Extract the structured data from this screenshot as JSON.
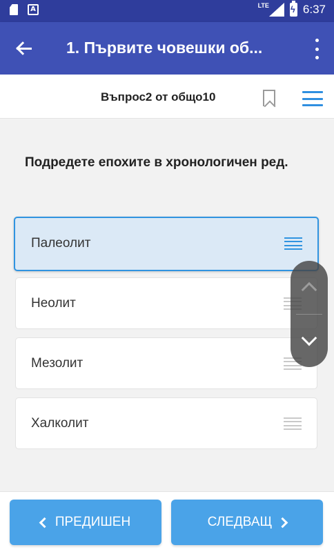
{
  "status_bar": {
    "network": "LTE",
    "time": "6:37",
    "icons": [
      "sd-card-icon",
      "app-store-icon",
      "signal-icon",
      "battery-charging-icon"
    ]
  },
  "app_bar": {
    "title": "1. Първите човешки об...",
    "back_icon": "arrow-back-icon",
    "more_icon": "more-vert-icon"
  },
  "question_header": {
    "counter": "Въпрос2 от общо10",
    "bookmark_icon": "bookmark-icon",
    "menu_icon": "menu-icon"
  },
  "question": {
    "text": "Подредете епохите в хронологичен ред."
  },
  "answers": [
    {
      "label": "Палеолит",
      "selected": true
    },
    {
      "label": "Неолит",
      "selected": false
    },
    {
      "label": "Мезолит",
      "selected": false
    },
    {
      "label": "Халколит",
      "selected": false
    }
  ],
  "reorder_control": {
    "up_icon": "chevron-up-icon",
    "down_icon": "chevron-down-icon"
  },
  "navigation": {
    "prev_label": "ПРЕДИШЕН",
    "next_label": "СЛЕДВАЩ"
  },
  "colors": {
    "status_bar": "#2f3d9c",
    "app_bar": "#3f51b5",
    "accent": "#2f93e0",
    "selected_bg": "#dbe9f6",
    "button": "#4aa3e8"
  }
}
